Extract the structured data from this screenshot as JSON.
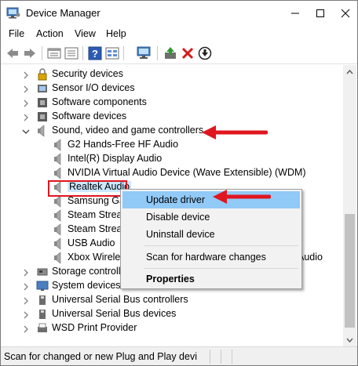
{
  "window": {
    "title": "Device Manager"
  },
  "menu": [
    "File",
    "Action",
    "View",
    "Help"
  ],
  "icons": {
    "app": "device-manager-icon",
    "minimize": "minimize-icon",
    "maximize": "maximize-icon",
    "close": "close-icon",
    "back": "back-arrow-icon",
    "forward": "forward-arrow-icon",
    "properties": "properties-icon",
    "show_hidden": "show-hidden-icon",
    "help": "help-icon",
    "view_resources": "view-resources-icon",
    "scan": "scan-hardware-icon",
    "update": "update-driver-icon",
    "uninstall": "uninstall-icon",
    "disable": "disable-device-icon"
  },
  "tree": {
    "top_categories": [
      "Security devices",
      "Sensor I/O devices",
      "Software components",
      "Software devices"
    ],
    "expanded_category": "Sound, video and game controllers",
    "children": [
      "G2 Hands-Free HF Audio",
      "Intel(R) Display Audio",
      "NVIDIA Virtual Audio Device (Wave Extensible) (WDM)",
      "Realtek Audio",
      "Samsung Ga",
      "Steam Strea",
      "Steam Strea",
      "USB Audio",
      "Xbox Wireles"
    ],
    "child_tail_audio": "Audio",
    "bottom_categories": [
      "Storage controll",
      "System devices",
      "Universal Serial Bus controllers",
      "Universal Serial Bus devices",
      "WSD Print Provider"
    ]
  },
  "context_menu": {
    "items": [
      "Update driver",
      "Disable device",
      "Uninstall device",
      "Scan for hardware changes",
      "Properties"
    ],
    "highlighted": "Update driver"
  },
  "status": {
    "text": "Scan for changed or new Plug and Play devi"
  },
  "colors": {
    "annotation_red": "#e0161f",
    "selection": "#cce8ff",
    "menu_highlight": "#91c9f7"
  }
}
